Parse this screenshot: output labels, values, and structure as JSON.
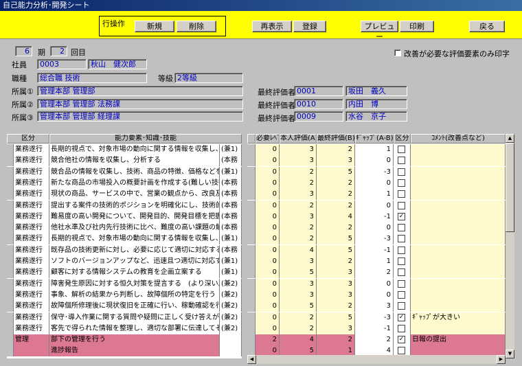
{
  "window": {
    "title": "自己能力分析･開発シート"
  },
  "toolbar": {
    "group_label": "行操作",
    "new_label": "新規",
    "delete_label": "削除",
    "refresh_label": "再表示",
    "register_label": "登録",
    "preview_label": "プレビュー",
    "print_label": "印刷",
    "back_label": "戻る"
  },
  "form": {
    "period_value": "6",
    "period_label": "期",
    "round_value": "2",
    "round_label": "回目",
    "improve_only_label": "改善が必要な評価要素のみ印字",
    "employee_label": "社員",
    "employee_code": "0003",
    "employee_name": "秋山　健次郎",
    "job_label": "職種",
    "job_value": "総合職 技術",
    "grade_label": "等級",
    "grade_value": "2等級",
    "dept1_label": "所属①",
    "dept1_value": "管理本部 管理部",
    "dept2_label": "所属②",
    "dept2_value": "管理本部 管理部 法務課",
    "dept3_label": "所属③",
    "dept3_value": "管理本部 管理部 経理課",
    "evaluator_label": "最終評価者",
    "evaluator1_code": "0001",
    "evaluator1_name": "坂田　義久",
    "evaluator2_code": "0010",
    "evaluator2_name": "内田　博",
    "evaluator3_code": "0009",
    "evaluator3_name": "水谷　京子"
  },
  "left_headers": {
    "category": "区分",
    "skill": "能力要素･知識･技能"
  },
  "right_headers": {
    "required": "必要ﾚﾍﾞﾙ",
    "self": "本人評価(A)",
    "final": "最終評価(B)",
    "gap": "ｷﾞｬｯﾌﾟ(A-B)",
    "flag": "区分",
    "comment": "ｺﾒﾝﾄ(改善点など)"
  },
  "rows": [
    {
      "category": "業務遂行",
      "skill": "長期的視点で、対象市場の動向に関する情報を収集し、分析",
      "tag": "(兼1)",
      "required": "0",
      "self": "3",
      "final": "2",
      "gap": "1",
      "checked": "",
      "comment": ""
    },
    {
      "category": "業務遂行",
      "skill": "競合他社の情報を収集し、分析する",
      "tag": "(本務",
      "required": "0",
      "self": "3",
      "final": "3",
      "gap": "0",
      "checked": "",
      "comment": ""
    },
    {
      "category": "業務遂行",
      "skill": "競合品の情報を収集し、技術、商品の特徴、価格などを正確に",
      "tag": "(兼1)",
      "required": "0",
      "self": "2",
      "final": "5",
      "gap": "-3",
      "checked": "",
      "comment": ""
    },
    {
      "category": "業務遂行",
      "skill": "新たな商品の市場投入の概要計画を作成する(難しい技術を",
      "tag": "(本務",
      "required": "0",
      "self": "2",
      "final": "2",
      "gap": "0",
      "checked": "",
      "comment": ""
    },
    {
      "category": "業務遂行",
      "skill": "現状の商品、サービスの中で、営業の観点から、改良及び廃棄",
      "tag": "(本務",
      "required": "0",
      "self": "3",
      "final": "2",
      "gap": "1",
      "checked": "",
      "comment": ""
    },
    {
      "category": "業務遂行",
      "skill": "提出する案件の技術的ポジションを明確化にし、技術的広がりが",
      "tag": "(本務",
      "required": "0",
      "self": "2",
      "final": "2",
      "gap": "0",
      "checked": "",
      "comment": ""
    },
    {
      "category": "業務遂行",
      "skill": "難易度の高い開発について、開発目的、開発目標を把握し、仕",
      "tag": "(本務",
      "required": "0",
      "self": "3",
      "final": "4",
      "gap": "-1",
      "checked": "✓",
      "comment": ""
    },
    {
      "category": "業務遂行",
      "skill": "他社水準及び社内先行技術に比べ、難度の高い課題の解決",
      "tag": "(本務",
      "required": "0",
      "self": "2",
      "final": "2",
      "gap": "0",
      "checked": "",
      "comment": ""
    },
    {
      "category": "業務遂行",
      "skill": "長期的視点で、対象市場の動向に関する情報を収集し、分析",
      "tag": "(兼1)",
      "required": "0",
      "self": "2",
      "final": "5",
      "gap": "-3",
      "checked": "",
      "comment": ""
    },
    {
      "category": "業務遂行",
      "skill": "既存品の技術更新に対し、必要に応じて適切に対応する",
      "tag": "(本務",
      "required": "0",
      "self": "4",
      "final": "5",
      "gap": "-1",
      "checked": "",
      "comment": ""
    },
    {
      "category": "業務遂行",
      "skill": "ソフトのバージョンアップなど、迅速且つ適切に対応する",
      "tag": "(兼1)",
      "required": "0",
      "self": "3",
      "final": "2",
      "gap": "1",
      "checked": "",
      "comment": ""
    },
    {
      "category": "業務遂行",
      "skill": "顧客に対する情報システムの教育を企画立案する",
      "tag": "(兼1)",
      "required": "0",
      "self": "5",
      "final": "3",
      "gap": "2",
      "checked": "",
      "comment": ""
    },
    {
      "category": "業務遂行",
      "skill": "障害発生原因に対する恒久対策を提言する　(より深い原因に",
      "tag": "(兼2)",
      "required": "0",
      "self": "3",
      "final": "3",
      "gap": "0",
      "checked": "",
      "comment": ""
    },
    {
      "category": "業務遂行",
      "skill": "事象、解析の結果から判断し、故障個所の特定を行う",
      "tag": "(兼2)",
      "required": "0",
      "self": "3",
      "final": "3",
      "gap": "0",
      "checked": "",
      "comment": ""
    },
    {
      "category": "業務遂行",
      "skill": "故障個所修理後に現状復旧を正確に行い、稼動確認を行う",
      "tag": "(兼2)",
      "required": "0",
      "self": "5",
      "final": "2",
      "gap": "3",
      "checked": "",
      "comment": ""
    },
    {
      "category": "業務遂行",
      "skill": "保守･導入作業に関する質問や疑問に正しく受け答えができる",
      "tag": "(兼2)",
      "required": "0",
      "self": "2",
      "final": "5",
      "gap": "-3",
      "checked": "✓",
      "comment": "ｷﾞｬｯﾌﾟが大きい"
    },
    {
      "category": "業務遂行",
      "skill": "客先で得られた情報を整理し、適切な部署に伝達してその後の",
      "tag": "(兼2)",
      "required": "0",
      "self": "2",
      "final": "3",
      "gap": "-1",
      "checked": "",
      "comment": ""
    },
    {
      "category": "管理",
      "skill": "部下の管理を行う",
      "tag": "",
      "required": "2",
      "self": "4",
      "final": "2",
      "gap": "2",
      "checked": "✓",
      "comment": "日報の提出",
      "kind": "mgmt"
    },
    {
      "category": "",
      "skill": "進捗報告",
      "tag": "",
      "required": "0",
      "self": "5",
      "final": "1",
      "gap": "4",
      "checked": "",
      "comment": "",
      "kind": "mgmt"
    }
  ],
  "colors": {
    "toolbar": "#ffff00",
    "mgmt_row": "#dc7892",
    "input_area": "#fffacd",
    "field_text": "#0000c0"
  }
}
